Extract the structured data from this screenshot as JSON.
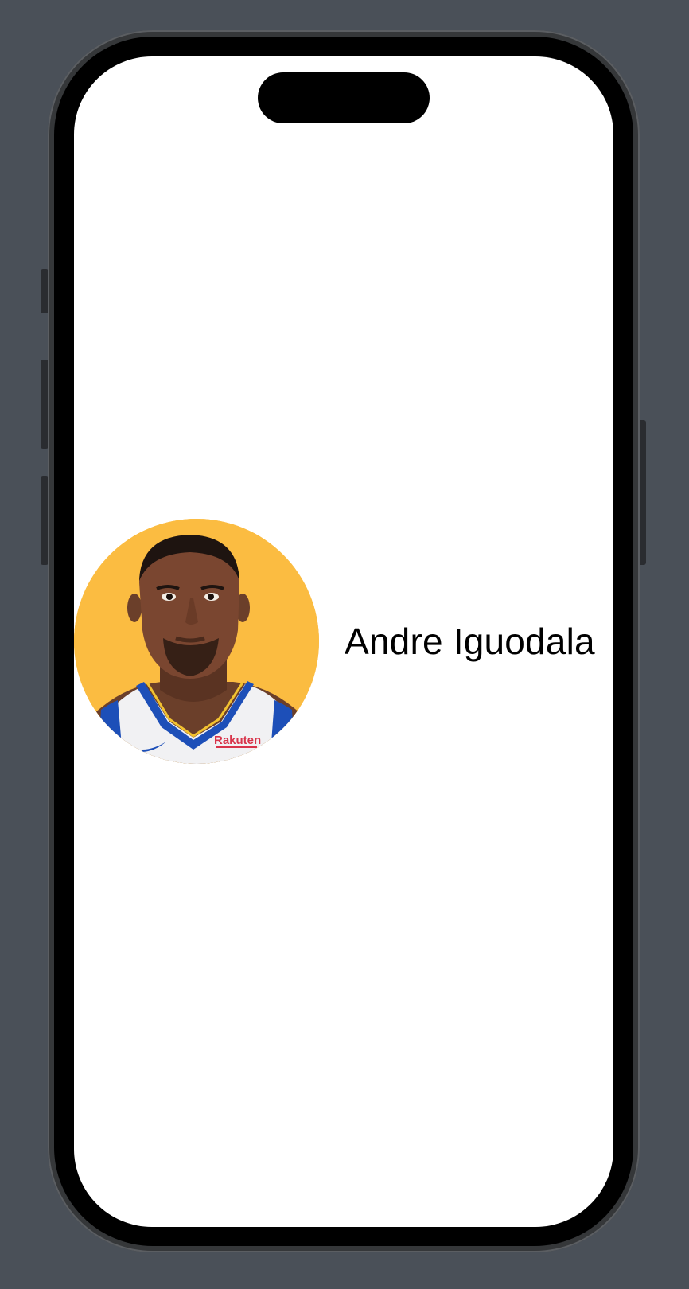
{
  "player": {
    "name": "Andre Iguodala",
    "avatar_background": "#fbbc41",
    "jersey_sponsor": "Rakuten"
  },
  "colors": {
    "desktop_background": "#4a5058",
    "screen_background": "#ffffff",
    "text": "#000000"
  }
}
